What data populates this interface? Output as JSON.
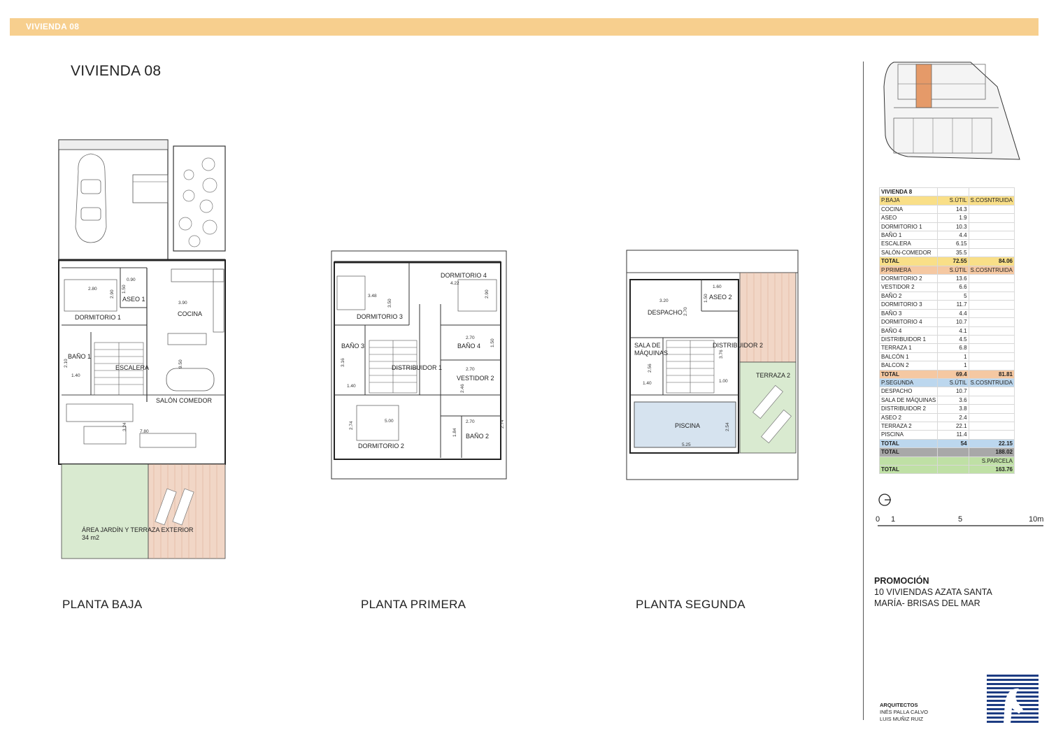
{
  "header": {
    "banner": "VIVIENDA 08",
    "title": "VIVIENDA 08"
  },
  "plans": {
    "baja": {
      "label": "PLANTA BAJA",
      "rooms": {
        "dormitorio1": "DORMITORIO 1",
        "aseo1": "ASEO 1",
        "cocina": "COCINA",
        "bano1": "BAÑO 1",
        "escalera": "ESCALERA",
        "salon": "SALÓN COMEDOR",
        "jardin": "ÁREA JARDÍN Y TERRAZA EXTERIOR",
        "jardin_area": "34 m2"
      },
      "dims": {
        "d1": "2.80",
        "d2": "2.90",
        "d3": "0.90",
        "d4": "1.50",
        "d5": "3.90",
        "d6": "2.10",
        "d7": "1.40",
        "d8": "9.50",
        "d9": "3.24",
        "d10": "7.80"
      }
    },
    "primera": {
      "label": "PLANTA PRIMERA",
      "rooms": {
        "dormitorio4": "DORMITORIO 4",
        "dormitorio3": "DORMITORIO 3",
        "bano3": "BAÑO 3",
        "bano4": "BAÑO 4",
        "distribuidor1": "DISTRIBUIDOR 1",
        "vestidor2": "VESTIDOR 2",
        "dormitorio2": "DORMITORIO 2",
        "bano2": "BAÑO 2"
      },
      "dims": {
        "d1": "4.22",
        "d2": "3.48",
        "d3": "3.50",
        "d4": "2.90",
        "d5": "2.70",
        "d6": "1.50",
        "d7": "3.16",
        "d8": "1.40",
        "d9": "2.70",
        "d10": "2.46",
        "d11": "5.00",
        "d12": "2.74",
        "d13": "2.70",
        "d14": "1.84",
        "d15": "2.74"
      }
    },
    "segunda": {
      "label": "PLANTA SEGUNDA",
      "rooms": {
        "despacho": "DESPACHO",
        "aseo2": "ASEO 2",
        "sala1": "SALA DE",
        "sala2": "MÁQUINAS",
        "distribuidor2": "DISTRIBUIDOR 2",
        "terraza2": "TERRAZA 2",
        "piscina": "PISCINA"
      },
      "dims": {
        "d1": "1.60",
        "d2": "3.20",
        "d3": "2.70",
        "d4": "1.50",
        "d5": "3.76",
        "d6": "2.56",
        "d7": "1.40",
        "d8": "1.00",
        "d9": "2.54",
        "d10": "5.25"
      }
    }
  },
  "table": {
    "header": "VIVIENDA 8",
    "sections": [
      {
        "name": "P.BAJA",
        "util_h": "S.ÚTIL",
        "cons_h": "S.COSNTRUIDA",
        "color": "#f9df88",
        "rows": [
          [
            "COCINA",
            "14.3"
          ],
          [
            "ASEO",
            "1.9"
          ],
          [
            "DORMITORIO 1",
            "10.3"
          ],
          [
            "BAÑO 1",
            "4.4"
          ],
          [
            "ESCALERA",
            "6.15"
          ],
          [
            "SALÓN-COMEDOR",
            "35.5"
          ]
        ],
        "total": [
          "TOTAL",
          "72.55",
          "84.06"
        ]
      },
      {
        "name": "P.PRIMERA",
        "util_h": "S.ÚTIL",
        "cons_h": "S.COSNTRUIDA",
        "color": "#f5c8a2",
        "rows": [
          [
            "DORMITORIO 2",
            "13.6"
          ],
          [
            "VESTIDOR 2",
            "6.6"
          ],
          [
            "BAÑO 2",
            "5"
          ],
          [
            "DORMITORIO 3",
            "11.7"
          ],
          [
            "BAÑO 3",
            "4.4"
          ],
          [
            "DORMITORIO 4",
            "10.7"
          ],
          [
            "BAÑO 4",
            "4.1"
          ],
          [
            "DISTRIBUIDOR 1",
            "4.5"
          ],
          [
            "TERRAZA 1",
            "6.8"
          ],
          [
            "BALCÓN 1",
            "1"
          ],
          [
            "BALCON 2",
            "1"
          ]
        ],
        "total": [
          "TOTAL",
          "69.4",
          "81.81"
        ]
      },
      {
        "name": "P.SEGUNDA",
        "util_h": "S.ÚTIL",
        "cons_h": "S.COSNTRUIDA",
        "color": "#bcd7ee",
        "rows": [
          [
            "DESPACHO",
            "10.7"
          ],
          [
            "SALA DE MÁQUINAS",
            "3.6"
          ],
          [
            "DISTRIBUIDOR 2",
            "3.8"
          ],
          [
            "ASEO 2",
            "2.4"
          ],
          [
            "TERRAZA 2",
            "22.1"
          ],
          [
            "PISCINA",
            "11.4"
          ]
        ],
        "total": [
          "TOTAL",
          "54",
          "22.15"
        ]
      }
    ],
    "grand_total": [
      "TOTAL",
      "",
      "188.02"
    ],
    "parcela_h": "S.PARCELA",
    "parcela_total": [
      "TOTAL",
      "",
      "163.76"
    ]
  },
  "scale": {
    "labels": [
      "0",
      "1",
      "5",
      "10m"
    ]
  },
  "promo": {
    "label": "PROMOCIÓN",
    "line1": "10 VIVIENDAS AZATA SANTA",
    "line2": "MARÍA- BRISAS DEL MAR"
  },
  "architects": {
    "label": "ARQUITECTOS",
    "name1": "INÉS PALLA CALVO",
    "name2": "LUIS MUÑIZ RUIZ"
  }
}
